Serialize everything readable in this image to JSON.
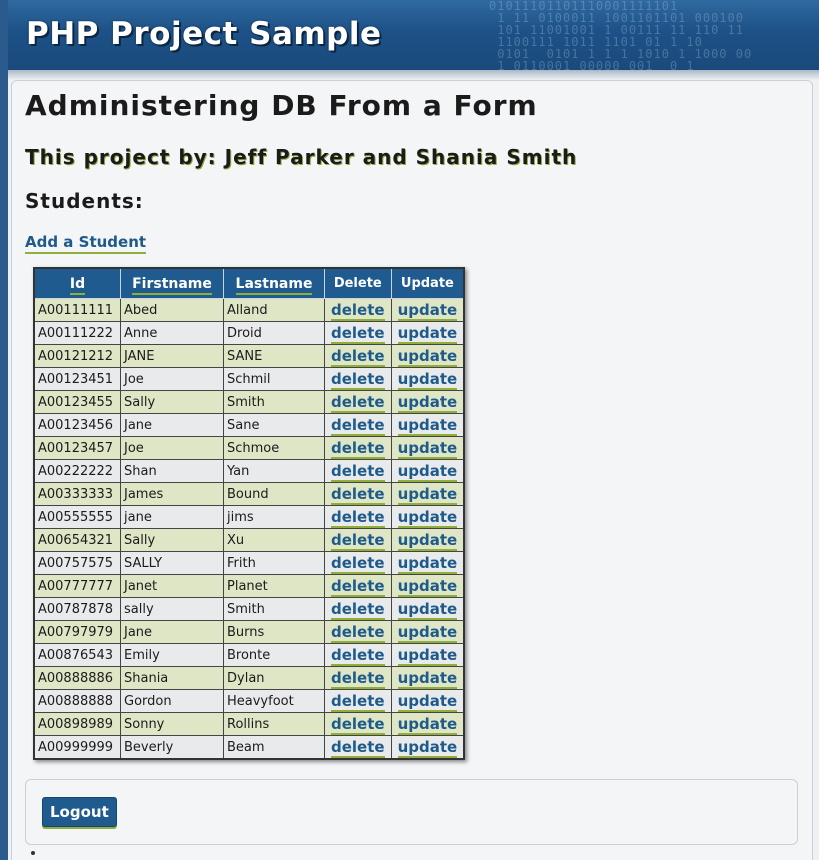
{
  "header": {
    "title": "PHP Project Sample",
    "binary_pattern": "01011101101110001111101\n 1 11 0100011 1001101101 000100\n 101 11001001 1 00111 11 110 11\n 1100111 1011 1101 01 1 10\n 0101  0101 1 1 1 1010 1 1000 00\n 1 0110001 00000 001  0 1\n"
  },
  "page": {
    "title": "Administering DB From a Form",
    "byline": "This project by: Jeff Parker and Shania Smith",
    "section_heading": "Students:",
    "add_link": "Add a Student"
  },
  "table": {
    "headers": {
      "id": "Id",
      "firstname": "Firstname",
      "lastname": "Lastname",
      "delete": "Delete",
      "update": "Update"
    },
    "delete_label": "delete",
    "update_label": "update",
    "rows": [
      {
        "id": "A00111111",
        "first": "Abed",
        "last": "Alland"
      },
      {
        "id": "A00111222",
        "first": "Anne",
        "last": "Droid"
      },
      {
        "id": "A00121212",
        "first": "JANE",
        "last": "SANE"
      },
      {
        "id": "A00123451",
        "first": "Joe",
        "last": "Schmil"
      },
      {
        "id": "A00123455",
        "first": "Sally",
        "last": "Smith"
      },
      {
        "id": "A00123456",
        "first": "Jane",
        "last": "Sane"
      },
      {
        "id": "A00123457",
        "first": "Joe",
        "last": "Schmoe"
      },
      {
        "id": "A00222222",
        "first": "Shan",
        "last": "Yan"
      },
      {
        "id": "A00333333",
        "first": "James",
        "last": "Bound"
      },
      {
        "id": "A00555555",
        "first": "jane",
        "last": "jims"
      },
      {
        "id": "A00654321",
        "first": "Sally",
        "last": "Xu"
      },
      {
        "id": "A00757575",
        "first": "SALLY",
        "last": "Frith"
      },
      {
        "id": "A00777777",
        "first": "Janet",
        "last": "Planet"
      },
      {
        "id": "A00787878",
        "first": "sally",
        "last": "Smith"
      },
      {
        "id": "A00797979",
        "first": "Jane",
        "last": "Burns"
      },
      {
        "id": "A00876543",
        "first": "Emily",
        "last": "Bronte"
      },
      {
        "id": "A00888886",
        "first": "Shania",
        "last": "Dylan"
      },
      {
        "id": "A00888888",
        "first": "Gordon",
        "last": "Heavyfoot"
      },
      {
        "id": "A00898989",
        "first": "Sonny",
        "last": "Rollins"
      },
      {
        "id": "A00999999",
        "first": "Beverly",
        "last": "Beam"
      }
    ]
  },
  "footer": {
    "logout_label": "Logout"
  },
  "colors": {
    "header_blue": "#1f5b8f",
    "accent_green": "#8fae3c",
    "link_blue": "#1e5a8a",
    "row_odd": "#dfe6c6",
    "row_even": "#e9eaec"
  }
}
